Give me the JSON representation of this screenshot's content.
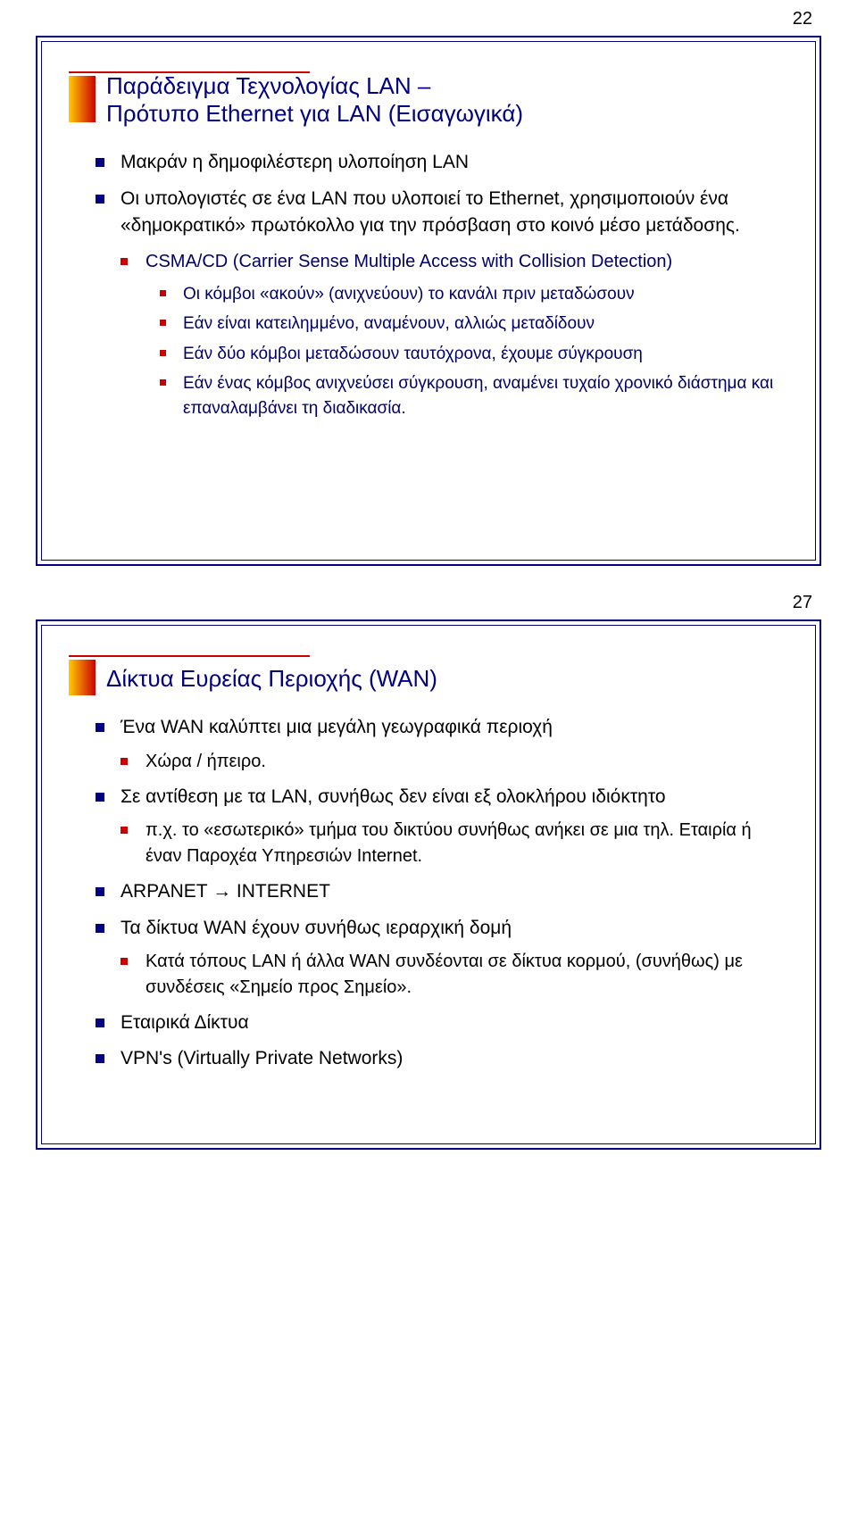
{
  "slide1": {
    "pagenum": "22",
    "title_line1": "Παράδειγμα Τεχνολογίας LAN –",
    "title_line2": "Πρότυπο Ethernet για LAN (Εισαγωγικά)",
    "items": [
      "Μακράν η δημοφιλέστερη υλοποίηση LAN",
      "Οι υπολογιστές σε ένα LAN που υλοποιεί το Ethernet, χρησιμοποιούν ένα «δημοκρατικό» πρωτόκολλο για την πρόσβαση στο κοινό μέσο μετάδοσης."
    ],
    "csma_title": "CSMA/CD (Carrier Sense Multiple Access with Collision Detection)",
    "csma_bullets": [
      "Οι κόμβοι «ακούν» (ανιχνεύουν) το κανάλι πριν μεταδώσουν",
      "Εάν είναι κατειλημμένο, αναμένουν, αλλιώς μεταδίδουν",
      "Εάν δύο κόμβοι μεταδώσουν ταυτόχρονα, έχουμε σύγκρουση",
      "Εάν ένας κόμβος ανιχνεύσει σύγκρουση, αναμένει τυχαίο χρονικό διάστημα και επαναλαμβάνει τη διαδικασία."
    ]
  },
  "slide2": {
    "pagenum": "27",
    "title": "Δίκτυα Ευρείας Περιοχής (WAN)",
    "b1": "Ένα WAN καλύπτει μια μεγάλη γεωγραφικά περιοχή",
    "b1_sub": "Χώρα / ήπειρο.",
    "b2": "Σε αντίθεση με τα LAN, συνήθως δεν είναι εξ ολοκλήρου ιδιόκτητο",
    "b2_sub": "π.χ. το «εσωτερικό» τμήμα του δικτύου συνήθως ανήκει σε μια τηλ. Εταιρία ή έναν Παροχέα Υπηρεσιών Internet.",
    "b3": "ARPANET → INTERNET",
    "b4": "Τα δίκτυα WAN έχουν συνήθως ιεραρχική δομή",
    "b4_sub": "Κατά τόπους LAN ή άλλα WAN συνδέονται σε δίκτυα κορμού, (συνήθως) με συνδέσεις «Σημείο προς Σημείο».",
    "b5": "Εταιρικά Δίκτυα",
    "b6": "VPN's (Virtually Private Networks)"
  }
}
